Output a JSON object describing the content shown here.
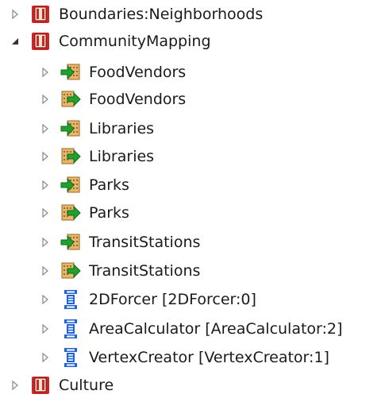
{
  "tree": {
    "nodes": [
      {
        "label": "Boundaries:Neighborhoods",
        "level": 0,
        "expanded": false,
        "icon": "folder-book-icon"
      },
      {
        "label": "CommunityMapping",
        "level": 0,
        "expanded": true,
        "icon": "folder-book-icon"
      },
      {
        "label": "FoodVendors",
        "level": 1,
        "expanded": false,
        "icon": "reader-arrow-icon"
      },
      {
        "label": "FoodVendors",
        "level": 1,
        "expanded": false,
        "icon": "writer-arrow-icon"
      },
      {
        "label": "Libraries",
        "level": 1,
        "expanded": false,
        "icon": "reader-arrow-icon"
      },
      {
        "label": "Libraries",
        "level": 1,
        "expanded": false,
        "icon": "writer-arrow-icon"
      },
      {
        "label": "Parks",
        "level": 1,
        "expanded": false,
        "icon": "reader-arrow-icon"
      },
      {
        "label": "Parks",
        "level": 1,
        "expanded": false,
        "icon": "writer-arrow-icon"
      },
      {
        "label": "TransitStations",
        "level": 1,
        "expanded": false,
        "icon": "reader-arrow-icon"
      },
      {
        "label": "TransitStations",
        "level": 1,
        "expanded": false,
        "icon": "writer-arrow-icon"
      },
      {
        "label": "2DForcer [2DForcer:0]",
        "level": 1,
        "expanded": false,
        "icon": "transformer-icon"
      },
      {
        "label": "AreaCalculator [AreaCalculator:2]",
        "level": 1,
        "expanded": false,
        "icon": "transformer-icon"
      },
      {
        "label": "VertexCreator [VertexCreator:1]",
        "level": 1,
        "expanded": false,
        "icon": "transformer-icon"
      },
      {
        "label": "Culture",
        "level": 0,
        "expanded": false,
        "icon": "folder-book-icon"
      }
    ]
  },
  "colors": {
    "folder_red": "#c8282a",
    "folder_tan": "#e8b56a",
    "arrow_green": "#21a02c",
    "transformer_blue": "#1f63d6"
  }
}
